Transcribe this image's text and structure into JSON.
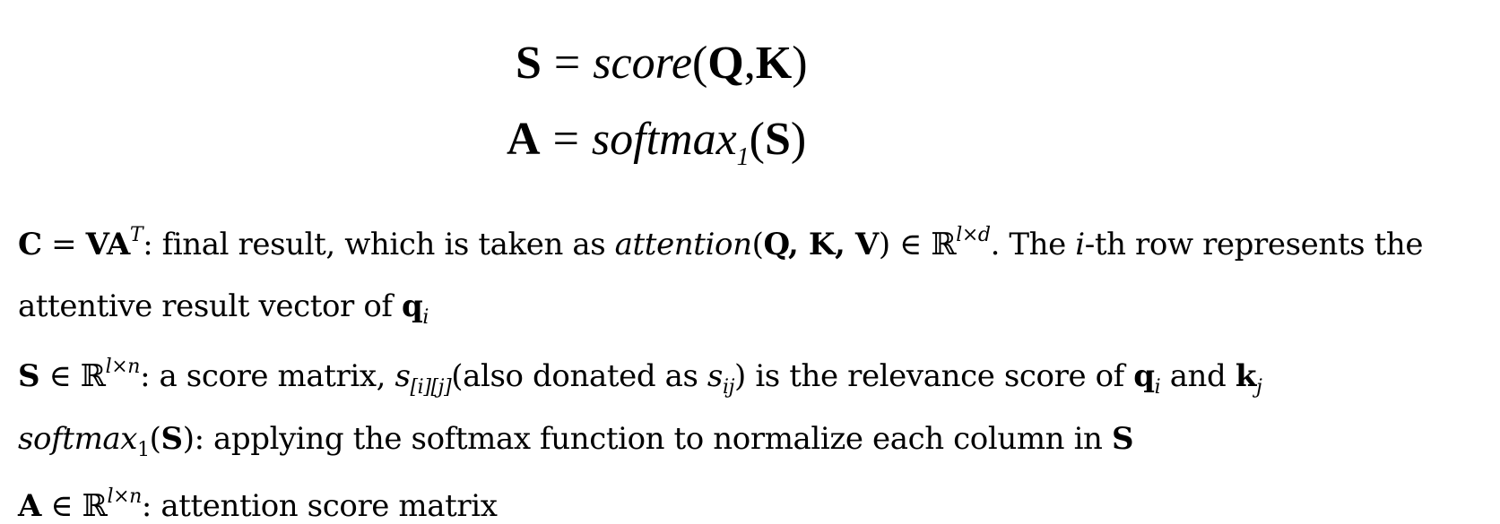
{
  "equations": {
    "score": {
      "lhs": "S",
      "eq": "=",
      "fn": "score",
      "lp": "(",
      "arg1": "Q",
      "comma": ",",
      "arg2": "K",
      "rp": ")"
    },
    "softmax": {
      "lhs": "A",
      "eq": "=",
      "fn": "softmax",
      "sub": "1",
      "lp": "(",
      "arg": "S",
      "rp": ")"
    }
  },
  "definitions": {
    "c": {
      "sym_c": "C",
      "eq": " = ",
      "sym_va": "VA",
      "sup_t": "T",
      "text1": ": final result, which is taken as ",
      "fn": "attention",
      "args_open": "(",
      "args": "Q, K, V",
      "args_close": ")",
      "in": " ∈ ",
      "reals": "ℝ",
      "dims": "l×d",
      "text2": ". The ",
      "i": "i",
      "text3": "-th row represents the",
      "text4": "attentive result vector of ",
      "q": "q",
      "q_sub": "i"
    },
    "s": {
      "sym": "S",
      "in": " ∈ ",
      "reals": "ℝ",
      "dims": "l×n",
      "text1": ": a score matrix, ",
      "s": "s",
      "s_sub": "[i][j]",
      "text2": "(also donated as ",
      "s2": "s",
      "s2_sub": "ij",
      "text3": ") is the relevance score of ",
      "q": "q",
      "q_sub": "i",
      "and": " and ",
      "k": "k",
      "k_sub": "j"
    },
    "softmax": {
      "fn": "softmax",
      "sub": "1",
      "open": "(",
      "arg": "S",
      "close": ")",
      "text": ": applying the softmax function to normalize each column in ",
      "sym": "S"
    },
    "a": {
      "sym": "A",
      "in": " ∈ ",
      "reals": "ℝ",
      "dims": "l×n",
      "text": ": attention score matrix"
    }
  }
}
